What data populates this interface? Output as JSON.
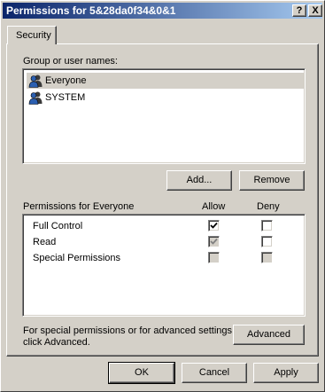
{
  "window": {
    "title": "Permissions for 5&28da0f34&0&1",
    "help_label": "?",
    "close_label": "X"
  },
  "tabs": [
    {
      "label": "Security"
    }
  ],
  "groups": {
    "label": "Group or user names:",
    "items": [
      {
        "name": "Everyone",
        "icon": "users-group-icon",
        "selected": true
      },
      {
        "name": "SYSTEM",
        "icon": "users-group-icon",
        "selected": false
      }
    ],
    "add_label": "Add...",
    "remove_label": "Remove"
  },
  "permissions": {
    "header": "Permissions for Everyone",
    "allow_header": "Allow",
    "deny_header": "Deny",
    "rows": [
      {
        "name": "Full Control",
        "allow": true,
        "allow_enabled": true,
        "deny": false,
        "deny_enabled": true
      },
      {
        "name": "Read",
        "allow": true,
        "allow_enabled": false,
        "deny": false,
        "deny_enabled": true
      },
      {
        "name": "Special Permissions",
        "allow": false,
        "allow_enabled": false,
        "deny": false,
        "deny_enabled": false
      }
    ]
  },
  "advanced": {
    "text_line1": "For special permissions or for advanced settings,",
    "text_line2": "click Advanced.",
    "button_label": "Advanced"
  },
  "footer": {
    "ok_label": "OK",
    "cancel_label": "Cancel",
    "apply_label": "Apply"
  }
}
